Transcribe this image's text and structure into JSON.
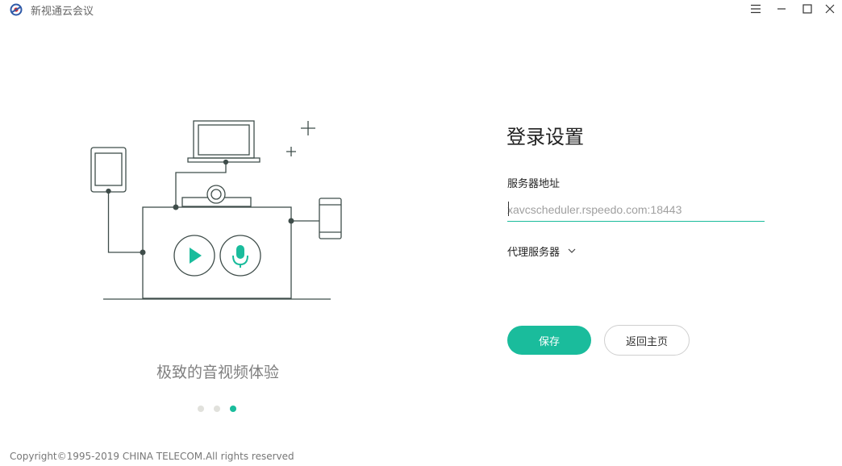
{
  "window": {
    "title": "新视通云会议",
    "icon": "app-logo",
    "controls": [
      "menu-icon",
      "minimize-icon",
      "maximize-icon",
      "close-icon"
    ]
  },
  "carousel": {
    "tagline": "极致的音视频体验",
    "slide_count": 3,
    "active_index": 3
  },
  "login_settings": {
    "title": "登录设置",
    "server_label": "服务器地址",
    "server_placeholder": "xavcscheduler.rspeedo.com:18443",
    "server_value": "",
    "proxy_label": "代理服务器",
    "save_label": "保存",
    "back_label": "返回主页"
  },
  "footer": {
    "copyright": "Copyright©1995-2019 CHINA TELECOM.All rights reserved"
  },
  "colors": {
    "accent": "#1abc9c",
    "illustration_stroke": "#3f4d4a",
    "text_muted": "#808080"
  }
}
